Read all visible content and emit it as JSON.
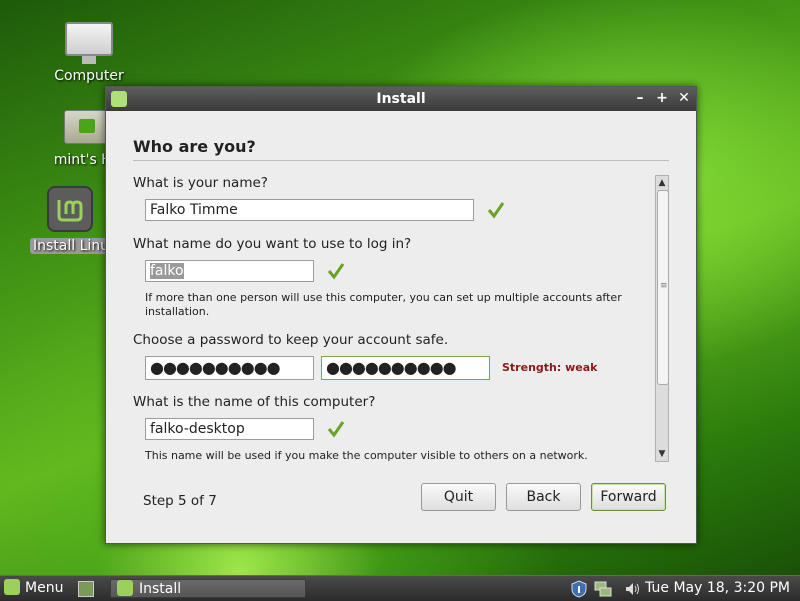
{
  "desktop": {
    "icons": [
      {
        "label": "Computer"
      },
      {
        "label": "mint's Ho"
      },
      {
        "label": "Install Linu"
      }
    ]
  },
  "window": {
    "title": "Install",
    "controls": {
      "minimize": "–",
      "maximize": "+",
      "close": "✕"
    }
  },
  "page": {
    "heading": "Who are you?",
    "name": {
      "question": "What is your name?",
      "value": "Falko Timme"
    },
    "login": {
      "question": "What name do you want to use to log in?",
      "value": "falko",
      "hint_line1": "If more than one person will use this computer, you can set up multiple accounts after",
      "hint_line2": "installation."
    },
    "password": {
      "question": "Choose a password to keep your account safe.",
      "value": "●●●●●●●●●●",
      "confirm": "●●●●●●●●●●",
      "strength": "Strength: weak"
    },
    "computer": {
      "question": "What is the name of this computer?",
      "value": "falko-desktop",
      "hint": "This name will be used if you make the computer visible to others on a network."
    }
  },
  "footer": {
    "step": "Step 5 of 7",
    "quit": "Quit",
    "back": "Back",
    "forward": "Forward"
  },
  "taskbar": {
    "menu": "Menu",
    "task": "Install",
    "clock": "Tue May 18,  3:20 PM"
  },
  "colors": {
    "accent": "#7cb342",
    "strength_weak": "#8b1a1a",
    "check": "#6aa325"
  }
}
